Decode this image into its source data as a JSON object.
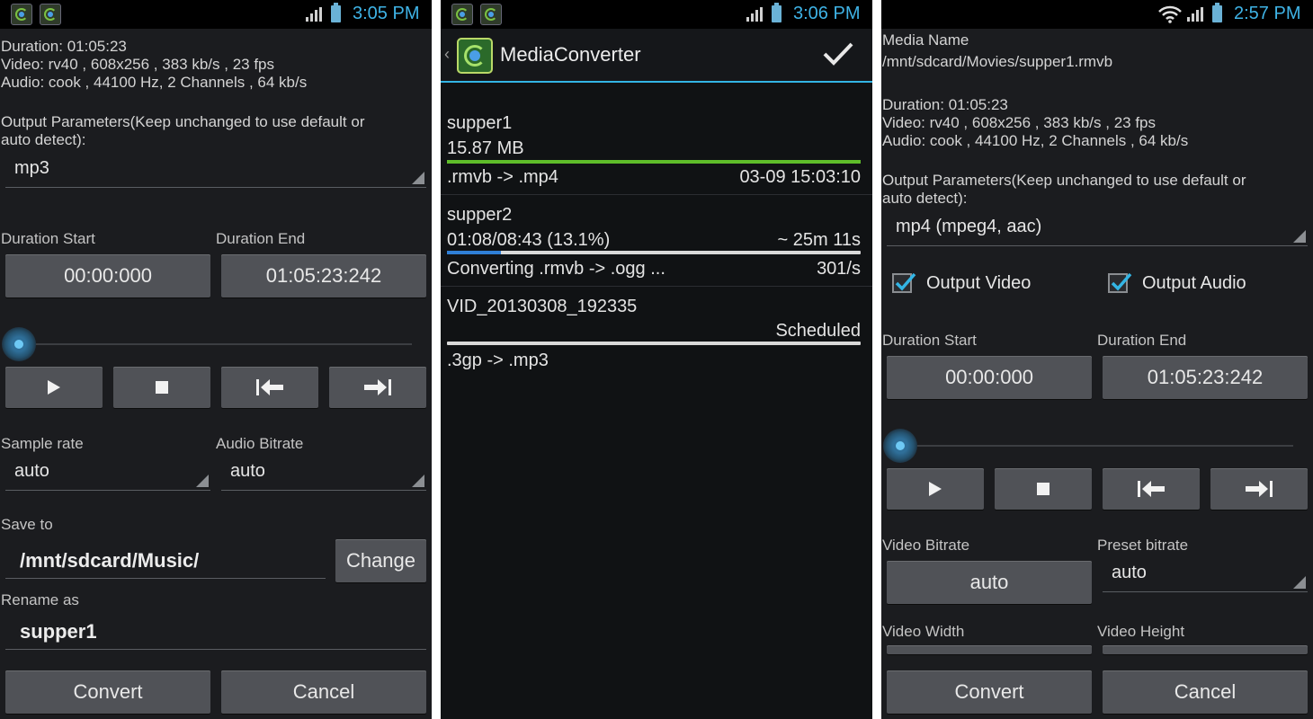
{
  "screen_left": {
    "status": {
      "time": "3:05 PM"
    },
    "media_info": {
      "duration": "Duration: 01:05:23",
      "video": "Video: rv40 , 608x256 , 383 kb/s , 23 fps",
      "audio": "Audio: cook , 44100 Hz, 2 Channels , 64 kb/s"
    },
    "output_params_label": "Output Parameters(Keep unchanged to use default or",
    "output_params_label2": "auto detect):",
    "format_value": "mp3",
    "duration_start_label": "Duration Start",
    "duration_end_label": "Duration End",
    "duration_start": "00:00:000",
    "duration_end": "01:05:23:242",
    "sample_rate_label": "Sample rate",
    "sample_rate_value": "auto",
    "audio_bitrate_label": "Audio Bitrate",
    "audio_bitrate_value": "auto",
    "save_to_label": "Save to",
    "save_to_value": "/mnt/sdcard/Music/",
    "change_button": "Change",
    "rename_label": "Rename as",
    "rename_value": "supper1",
    "convert_button": "Convert",
    "cancel_button": "Cancel"
  },
  "screen_middle": {
    "status": {
      "time": "3:06 PM"
    },
    "app_title": "MediaConverter",
    "items": [
      {
        "name": "supper1",
        "line2": "15.87 MB",
        "left": ".rmvb -> .mp4",
        "right": "03-09 15:03:10",
        "progress": 1.0,
        "color": "#5fbd2a"
      },
      {
        "name": "supper2",
        "line2": "01:08/08:43 (13.1%)",
        "line2_right": "~ 25m 11s",
        "left": "Converting .rmvb -> .ogg ...",
        "right": "301/s",
        "progress": 0.131,
        "color": "#2f7fd6"
      },
      {
        "name": "VID_20130308_192335",
        "line2_right": "Scheduled",
        "left": ".3gp -> .mp3",
        "progress": 0.0,
        "color": "#d9d9d9"
      }
    ]
  },
  "screen_right": {
    "status": {
      "time": "2:57 PM"
    },
    "media_name_label": "Media Name",
    "media_path": "/mnt/sdcard/Movies/supper1.rmvb",
    "media_info": {
      "duration": "Duration: 01:05:23",
      "video": "Video: rv40 , 608x256 , 383 kb/s , 23 fps",
      "audio": "Audio: cook , 44100 Hz, 2 Channels , 64 kb/s"
    },
    "output_params_label": "Output Parameters(Keep unchanged to use default or",
    "output_params_label2": "auto detect):",
    "format_value": "mp4 (mpeg4, aac)",
    "output_video_label": "Output Video",
    "output_audio_label": "Output Audio",
    "duration_start_label": "Duration Start",
    "duration_end_label": "Duration End",
    "duration_start": "00:00:000",
    "duration_end": "01:05:23:242",
    "video_bitrate_label": "Video Bitrate",
    "video_bitrate_value": "auto",
    "preset_bitrate_label": "Preset bitrate",
    "preset_bitrate_value": "auto",
    "video_width_label": "Video Width",
    "video_height_label": "Video Height",
    "convert_button": "Convert",
    "cancel_button": "Cancel"
  },
  "icons": [
    "app-icon",
    "signal-icon",
    "battery-icon",
    "wifi-icon",
    "play-icon",
    "stop-icon",
    "jump-start-icon",
    "jump-end-icon",
    "check-icon",
    "back-chevron-icon"
  ],
  "colors": {
    "accent": "#33b5e5",
    "clock": "#3fb3e6",
    "done_bar": "#5fbd2a",
    "progress_bar": "#2f7fd6"
  }
}
